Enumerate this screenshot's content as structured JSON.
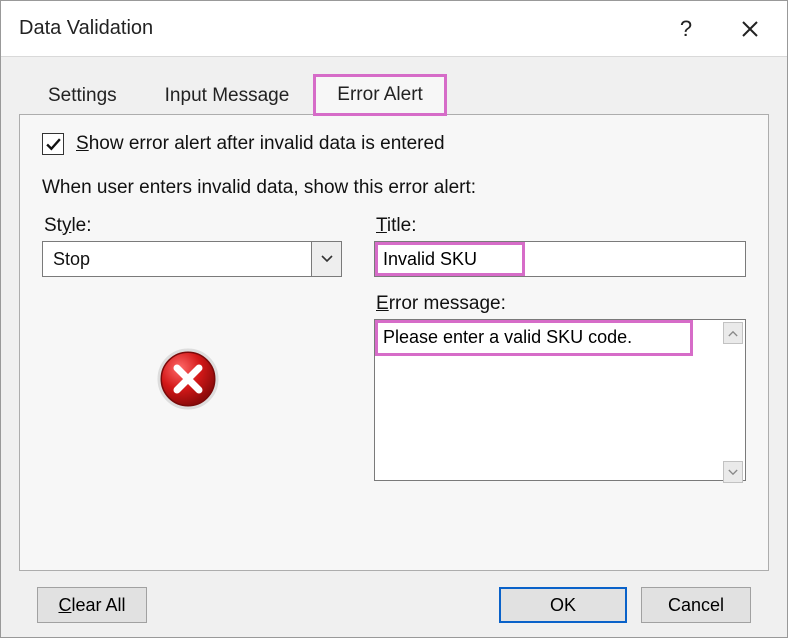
{
  "dialog": {
    "title": "Data Validation"
  },
  "tabs": {
    "settings": "Settings",
    "input_message": "Input Message",
    "error_alert": "Error Alert"
  },
  "panel": {
    "show_alert_label": "Show error alert after invalid data is entered",
    "show_alert_underline": "S",
    "show_alert_checked": true,
    "section_text": "When user enters invalid data, show this error alert:",
    "style_label": "Style:",
    "style_underline": "y",
    "style_value": "Stop",
    "title_label": "Title:",
    "title_underline": "T",
    "title_value": "Invalid SKU",
    "error_label": "Error message:",
    "error_underline": "E",
    "error_value": "Please enter a valid SKU code."
  },
  "buttons": {
    "clear_all": "Clear All",
    "clear_all_underline": "C",
    "ok": "OK",
    "cancel": "Cancel"
  }
}
